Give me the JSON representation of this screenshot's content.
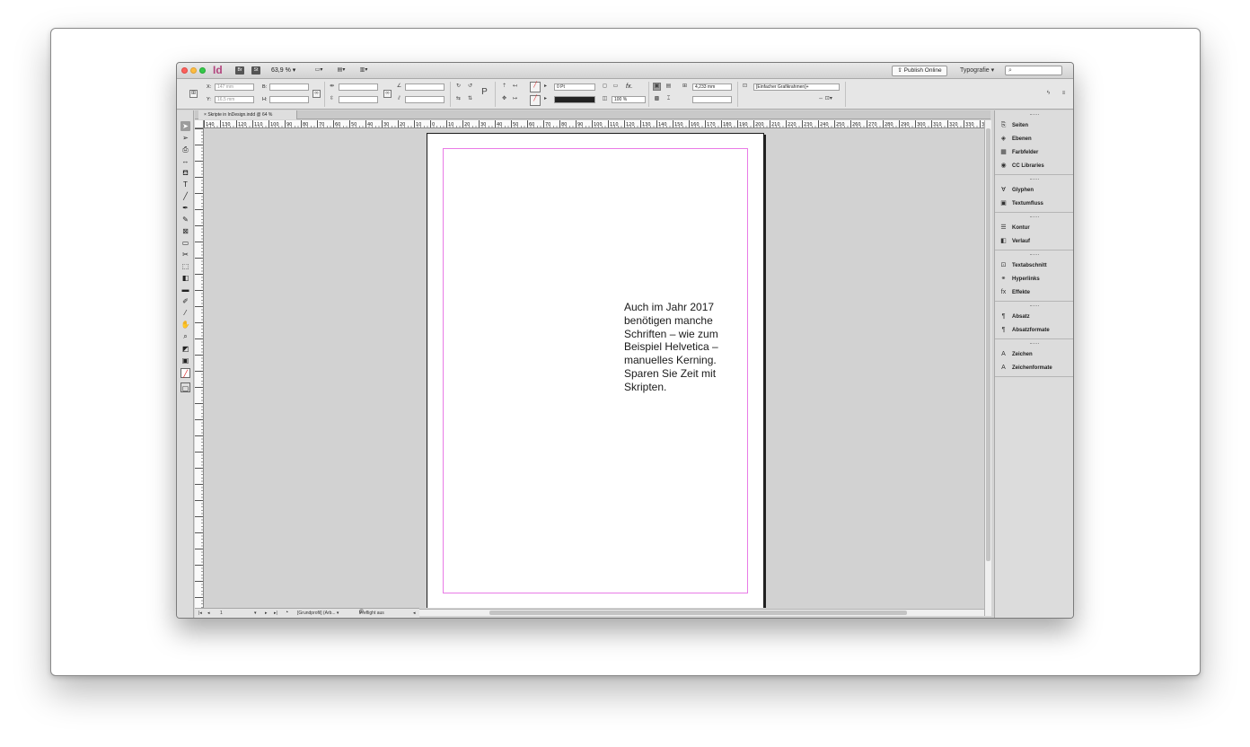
{
  "titlebar": {
    "app_logo": "Id",
    "zoom": "63,9 % ▾",
    "publish_online": "Publish Online",
    "workspace": "Typografie ▾",
    "search_placeholder": "⌕"
  },
  "control_bar": {
    "x_label": "X:",
    "x_value": "147 mm",
    "y_label": "Y:",
    "y_value": "16,5 mm",
    "w_label": "B:",
    "h_label": "H:",
    "stroke_weight": "0 Pt",
    "opacity": "100 %",
    "fitting_value": "4,233 mm",
    "object_style": "[Einfacher Grafikrahmen]+",
    "effects_label": "fx."
  },
  "document": {
    "tab_label": "Skripte in InDesign.indd @ 64 %",
    "ruler_labels": [
      "140",
      "130",
      "120",
      "110",
      "100",
      "90",
      "80",
      "70",
      "60",
      "50",
      "40",
      "30",
      "20",
      "10",
      "0",
      "10",
      "20",
      "30",
      "40",
      "50",
      "60",
      "70",
      "80",
      "90",
      "100",
      "110",
      "120",
      "130",
      "140",
      "150",
      "160",
      "170",
      "180",
      "190",
      "200",
      "210",
      "220",
      "230",
      "240",
      "250",
      "260",
      "270",
      "280",
      "290",
      "300",
      "310",
      "320",
      "330",
      "340"
    ],
    "body_text": "Auch im Jahr 2017\nbenötigen manche\nSchriften – wie zum\nBeispiel Helvetica –\nmanuelles Kerning.\nSparen Sie Zeit mit\nSkripten."
  },
  "status": {
    "page_number": "1",
    "profile": "[Grundprofil] (Arb... ▾",
    "preflight": "Preflight aus"
  },
  "panels": {
    "groups": [
      [
        {
          "label": "Seiten",
          "icon": "pages-icon",
          "glyph": "⎘"
        },
        {
          "label": "Ebenen",
          "icon": "layers-icon",
          "glyph": "◈"
        },
        {
          "label": "Farbfelder",
          "icon": "swatches-icon",
          "glyph": "▦"
        },
        {
          "label": "CC Libraries",
          "icon": "cc-libraries-icon",
          "glyph": "◉"
        }
      ],
      [
        {
          "label": "Glyphen",
          "icon": "glyphs-icon",
          "glyph": "Ɐ"
        },
        {
          "label": "Textumfluss",
          "icon": "text-wrap-icon",
          "glyph": "▣"
        }
      ],
      [
        {
          "label": "Kontur",
          "icon": "stroke-icon",
          "glyph": "☰"
        },
        {
          "label": "Verlauf",
          "icon": "gradient-icon",
          "glyph": "◧"
        }
      ],
      [
        {
          "label": "Textabschnitt",
          "icon": "story-icon",
          "glyph": "⊡"
        },
        {
          "label": "Hyperlinks",
          "icon": "hyperlinks-icon",
          "glyph": "⚭"
        },
        {
          "label": "Effekte",
          "icon": "effects-icon",
          "glyph": "fx"
        }
      ],
      [
        {
          "label": "Absatz",
          "icon": "paragraph-icon",
          "glyph": "¶"
        },
        {
          "label": "Absatzformate",
          "icon": "paragraph-styles-icon",
          "glyph": "¶"
        }
      ],
      [
        {
          "label": "Zeichen",
          "icon": "character-icon",
          "glyph": "A"
        },
        {
          "label": "Zeichenformate",
          "icon": "character-styles-icon",
          "glyph": "A"
        }
      ]
    ]
  },
  "colors": {
    "margin_guide": "#e97be6",
    "app_logo": "#b3457e"
  }
}
